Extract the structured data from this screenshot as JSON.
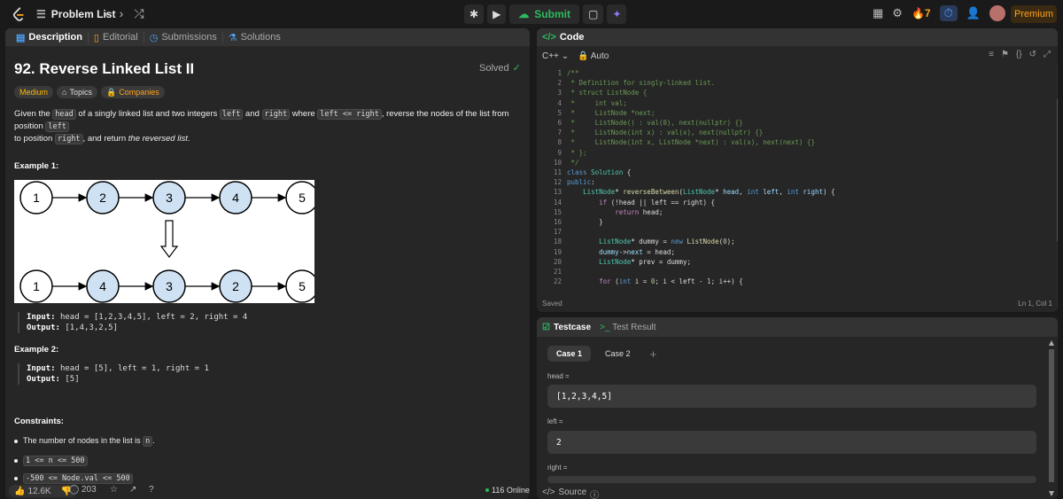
{
  "topbar": {
    "logo_icon": "leetcode-logo",
    "problem_list_label": "Problem List",
    "submit_label": "Submit",
    "streak_count": "7",
    "premium_label": "Premium"
  },
  "tabs": [
    {
      "label": "Description",
      "icon": "doc-icon"
    },
    {
      "label": "Editorial",
      "icon": "book-icon"
    },
    {
      "label": "Submissions",
      "icon": "flask-icon"
    },
    {
      "label": "Solutions",
      "icon": "flask-icon"
    }
  ],
  "problem": {
    "title": "92. Reverse Linked List II",
    "status": "Solved",
    "difficulty": "Medium",
    "topics_label": "Topics",
    "companies_label": "Companies",
    "desc_p1_a": "Given the ",
    "desc_head": "head",
    "desc_p1_b": " of a singly linked list and two integers ",
    "desc_left": "left",
    "desc_and": " and ",
    "desc_right": "right",
    "desc_where": " where ",
    "desc_cond": "left <= right",
    "desc_p1_c": ", reverse the nodes of the list from position ",
    "desc_left2": "left",
    "desc_p2_a": "to position ",
    "desc_right2": "right",
    "desc_p2_b": ", and return ",
    "desc_p2_em": "the reversed list",
    "desc_p2_end": "."
  },
  "example1": {
    "heading": "Example 1:",
    "top_row": [
      "1",
      "2",
      "3",
      "4",
      "5"
    ],
    "bottom_row": [
      "1",
      "4",
      "3",
      "2",
      "5"
    ],
    "input_label": "Input:",
    "input": "head = [1,2,3,4,5], left = 2, right = 4",
    "output_label": "Output:",
    "output": "[1,4,3,2,5]"
  },
  "example2": {
    "heading": "Example 2:",
    "input_label": "Input:",
    "input": "head = [5], left = 1, right = 1",
    "output_label": "Output:",
    "output": "[5]"
  },
  "constraints": {
    "heading": "Constraints:",
    "c1_text": "The number of nodes in the list is ",
    "c1_code": "n",
    "c1_end": ".",
    "c2": "1 <= n <= 500",
    "c3": "-500 <= Node.val <= 500"
  },
  "footer": {
    "likes": "12.6K",
    "comments": "203",
    "online": "116 Online"
  },
  "code": {
    "header": "Code",
    "language": "C++",
    "mode": "Auto",
    "status": "Saved",
    "cursor": "Ln 1, Col 1",
    "line_numbers": [
      "1",
      "2",
      "3",
      "4",
      "5",
      "6",
      "7",
      "8",
      "9",
      "10",
      "11",
      "12",
      "13",
      "14",
      "15",
      "16",
      "17",
      "18",
      "19",
      "20",
      "21",
      "22"
    ]
  },
  "testcase": {
    "tab_label": "Testcase",
    "result_label": "Test Result",
    "cases": [
      "Case 1",
      "Case 2"
    ],
    "head_label": "head =",
    "head_value": "[1,2,3,4,5]",
    "left_label": "left =",
    "left_value": "2",
    "right_label": "right =",
    "source_label": "Source"
  },
  "colors": {
    "accent_green": "#2cbb5d",
    "brand_orange": "#ffa116",
    "medium": "#ffb800"
  }
}
